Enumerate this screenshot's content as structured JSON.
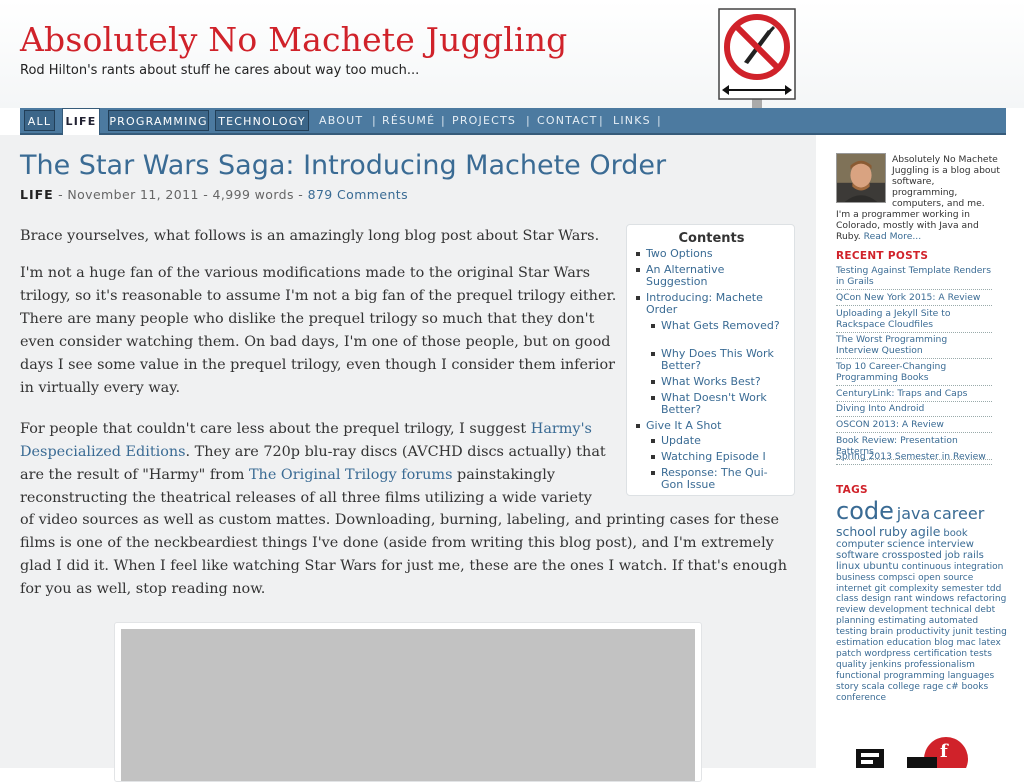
{
  "site": {
    "title": "Absolutely No Machete Juggling",
    "tagline": "Rod Hilton's rants about stuff he cares about way too much..."
  },
  "nav": {
    "tabs": [
      "ALL",
      "LIFE",
      "PROGRAMMING",
      "TECHNOLOGY"
    ],
    "active_tab": "LIFE",
    "links": [
      "ABOUT",
      "RÉSUMÉ",
      "PROJECTS",
      "CONTACT",
      "LINKS"
    ],
    "separator": "|"
  },
  "post": {
    "title": "The Star Wars Saga: Introducing Machete Order",
    "category": "LIFE",
    "date": "November 11, 2011",
    "words": "4,999 words",
    "comments_count": "879",
    "comments_label": "Comments",
    "meta_sep": "-",
    "p1": "Brace yourselves, what follows is an amazingly long blog post about Star Wars.",
    "p2": "I'm not a huge fan of the various modifications made to the original Star Wars trilogy, so it's reasonable to assume I'm not a big fan of the prequel trilogy either. There are many people who dislike the prequel trilogy so much that they don't even consider watching them. On bad days, I'm one of those people, but on good days I see some value in the prequel trilogy, even though I con­sider them inferior in virtually every way.",
    "p3_intro": "For people that couldn't care less about the prequel trilogy, I suggest ",
    "p3_link1": "Harmy's Despecialized Editions",
    "p3_mid1": ". They are 720p blu-ray discs (AVCHD discs actually) that are the result of \"Harmy\" from ",
    "p3_link2": "The Original Trilogy forums",
    "p3_mid2": " painstakingly reconstructing the theatrical releases of all three films utilizing a wide variety",
    "p3_rest": "of video sources as well as custom mattes. Downloading, burning, labeling, and printing cases for these films is one of the neckbeardiest things I've done (aside from writing this blog post), and I'm extremely glad I did it. When I feel like watching Star Wars for just me, these are the ones I watch. If that's enough for you as well, stop reading now."
  },
  "toc": {
    "title": "Contents",
    "items": [
      {
        "label": "Two Options"
      },
      {
        "label": "An Alternative Suggestion"
      },
      {
        "label": "Introducing: Machete Order"
      },
      {
        "label": "What Gets Removed?"
      },
      {
        "label": "Why Does This Work Better?"
      },
      {
        "label": "What Works Best?"
      },
      {
        "label": "What Doesn't Work Better?"
      },
      {
        "label": "Give It A Shot"
      },
      {
        "label": "Update"
      },
      {
        "label": "Watching Episode I"
      },
      {
        "label": "Response: The Qui-Gon Issue"
      }
    ]
  },
  "sidebar": {
    "about_text": "Absolutely No Machete Juggling is a blog about software, programming, computers, and me.",
    "about_text2": "I'm a programmer working in Colorado, mostly with Java and Ruby.",
    "read_more": "Read More...",
    "recent_heading": "RECENT POSTS",
    "recent_posts": [
      "Testing Against Template Renders in Grails",
      "QCon New York 2015: A Review",
      "Uploading a Jekyll Site to Rackspace Cloudfiles",
      "The Worst Programming Interview Question",
      "Top 10 Career-Changing Programming Books",
      "CenturyLink: Traps and Caps",
      "Diving Into Android",
      "OSCON 2013: A Review",
      "Book Review: Presentation Patterns",
      "Spring 2013 Semester in Review"
    ],
    "tags_heading": "TAGS",
    "tags_xl": [
      "code"
    ],
    "tags_lg": [
      "java",
      "career"
    ],
    "tags_md": [
      "school",
      "ruby",
      "agile"
    ],
    "tags_sm": [
      "book",
      "computer",
      "science",
      "interview",
      "software",
      "crossposted",
      "job",
      "rails",
      "linux",
      "ubuntu"
    ],
    "tags_xs": [
      "continuous",
      "integration",
      "business",
      "compsci",
      "open",
      "source",
      "internet",
      "git",
      "complexity",
      "semester",
      "tdd",
      "class",
      "design",
      "rant",
      "windows",
      "refactoring",
      "review",
      "development",
      "technical",
      "debt",
      "planning",
      "estimating",
      "automated",
      "testing",
      "brain",
      "productivity",
      "junit",
      "testing",
      "estimation",
      "education",
      "blog",
      "mac",
      "latex",
      "patch",
      "wordpress",
      "certification",
      "tests",
      "quality",
      "jenkins",
      "professionalism",
      "functional",
      "programming",
      "languages",
      "story",
      "scala",
      "college",
      "rage",
      "c#",
      "books",
      "conference"
    ]
  },
  "colors": {
    "title_red": "#d0222a",
    "link_blue": "#3a6b94",
    "nav_blue": "#4c7aa0"
  },
  "icons": {
    "logo": "no-machete-sign-icon",
    "avatar": "author-avatar",
    "bullet": "square-bullet-icon"
  }
}
